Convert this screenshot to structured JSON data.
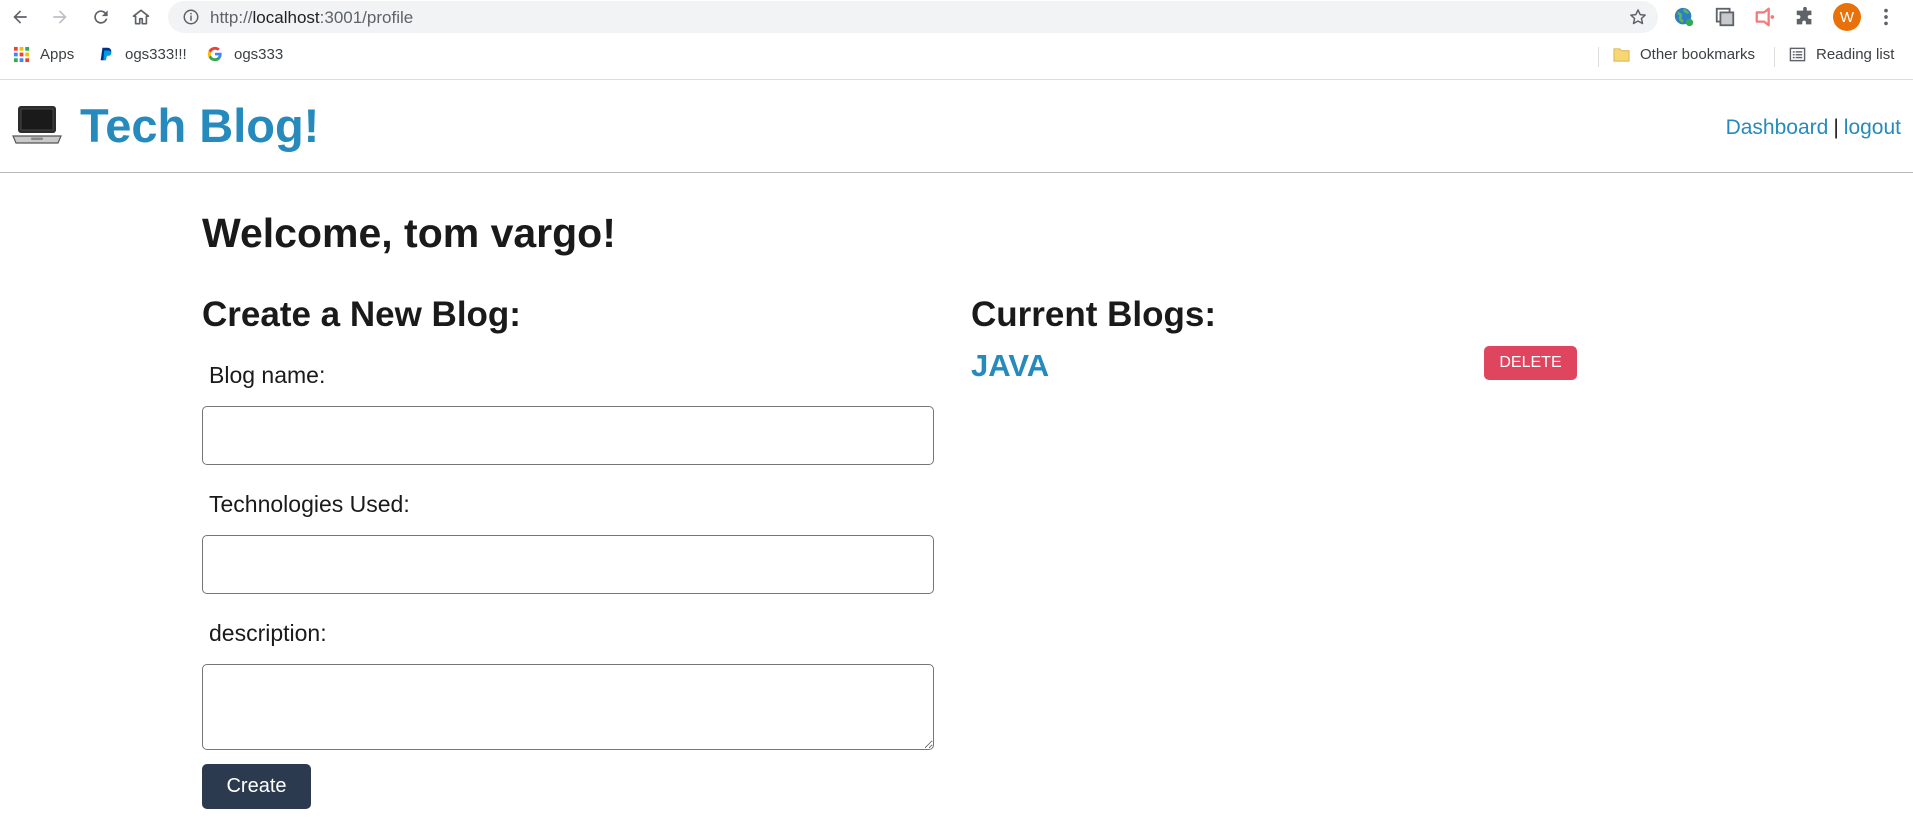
{
  "browser": {
    "url_scheme": "http://",
    "url_host": "localhost",
    "url_rest": ":3001/profile",
    "profile_initial": "W",
    "bookmarks": [
      {
        "label": "Apps",
        "icon": "apps-grid-icon"
      },
      {
        "label": "ogs333!!!",
        "icon": "paypal-icon"
      },
      {
        "label": "ogs333",
        "icon": "google-icon"
      }
    ],
    "other_bookmarks": "Other bookmarks",
    "reading_list": "Reading list"
  },
  "header": {
    "logo_icon": "laptop-icon",
    "title": "Tech Blog!",
    "nav": {
      "dashboard": "Dashboard",
      "separator": "|",
      "logout": "logout"
    }
  },
  "welcome": "Welcome, tom vargo!",
  "create_form": {
    "title": "Create a New Blog:",
    "name_label": "Blog name:",
    "name_value": "",
    "tech_label": "Technologies Used:",
    "tech_value": "",
    "description_label": "description:",
    "description_value": "",
    "submit_label": "Create"
  },
  "current_blogs": {
    "title": "Current Blogs:",
    "items": [
      {
        "name": "JAVA",
        "delete_label": "DELETE"
      }
    ]
  },
  "colors": {
    "link": "#268bbc",
    "delete": "#e0455f",
    "create": "#2b3a4e",
    "avatar": "#e8710a"
  }
}
